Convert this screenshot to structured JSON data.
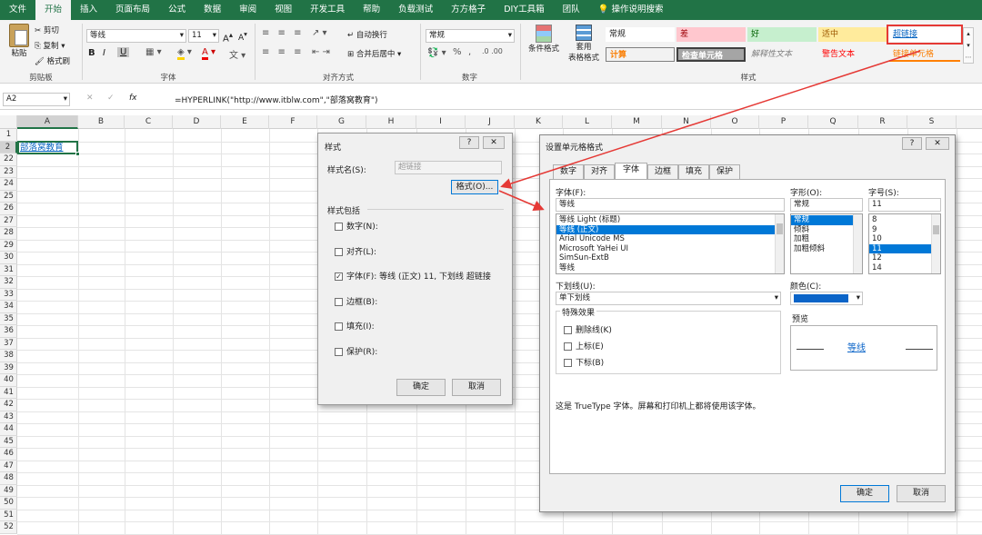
{
  "ribbon_tabs": [
    "文件",
    "开始",
    "插入",
    "页面布局",
    "公式",
    "数据",
    "审阅",
    "视图",
    "开发工具",
    "帮助",
    "负载测试",
    "方方格子",
    "DIY工具箱",
    "团队",
    "操作说明搜索"
  ],
  "clipboard": {
    "paste": "粘贴",
    "cut": "剪切",
    "copy": "复制",
    "format_painter": "格式刷",
    "label": "剪贴板"
  },
  "font": {
    "name": "等线",
    "size": "11",
    "label": "字体",
    "bold": "B",
    "italic": "I",
    "underline": "U",
    "grow": "A",
    "shrink": "A"
  },
  "alignment": {
    "wrap": "自动换行",
    "merge": "合并后居中",
    "label": "对齐方式"
  },
  "number": {
    "format": "常规",
    "percent": "%",
    "comma": ",",
    "label": "数字"
  },
  "styles_group": {
    "conditional": "条件格式",
    "table_format_1": "套用",
    "table_format_2": "表格格式",
    "label": "样式"
  },
  "styles": {
    "normal": "常规",
    "bad": "差",
    "good": "好",
    "neutral": "适中",
    "hyperlink": "超链接",
    "calculation": "计算",
    "check_cell": "检查单元格",
    "explanatory": "解释性文本",
    "warning": "警告文本",
    "linked_cell": "链接单元格"
  },
  "formula_bar": {
    "name_box": "A2",
    "cancel": "✕",
    "enter": "✓",
    "fx": "fx",
    "formula": "=HYPERLINK(\"http://www.itblw.com\",\"部落窝教育\")"
  },
  "columns": [
    "A",
    "B",
    "C",
    "D",
    "E",
    "F",
    "G",
    "H",
    "I",
    "J",
    "K",
    "L",
    "M",
    "N",
    "O",
    "P",
    "Q",
    "R",
    "S"
  ],
  "rows": [
    "1",
    "2",
    "22",
    "23",
    "24",
    "25",
    "26",
    "27",
    "28",
    "29",
    "30",
    "31",
    "32",
    "33",
    "34",
    "35",
    "36",
    "37",
    "38",
    "39",
    "40",
    "41",
    "42",
    "43",
    "44",
    "45",
    "46",
    "47",
    "48",
    "49",
    "50",
    "51",
    "52"
  ],
  "cell_a2": "部落窝教育",
  "style_dialog": {
    "title": "样式",
    "help": "?",
    "close": "✕",
    "style_name_label": "样式名(S):",
    "style_name_value": "超链接",
    "format_button": "格式(O)...",
    "includes_label": "样式包括",
    "items": [
      {
        "label": "数字(N):",
        "checked": false
      },
      {
        "label": "对齐(L):",
        "checked": false
      },
      {
        "label": "字体(F): 等线 (正文) 11, 下划线 超链接",
        "checked": true
      },
      {
        "label": "边框(B):",
        "checked": false
      },
      {
        "label": "填充(I):",
        "checked": false
      },
      {
        "label": "保护(R):",
        "checked": false
      }
    ],
    "ok": "确定",
    "cancel": "取消"
  },
  "format_dialog": {
    "title": "设置单元格格式",
    "help": "?",
    "close": "✕",
    "tabs": [
      "数字",
      "对齐",
      "字体",
      "边框",
      "填充",
      "保护"
    ],
    "font_label": "字体(F):",
    "font_value": "等线",
    "font_list": [
      "等线 Light (标题)",
      "等线 (正文)",
      "Arial Unicode MS",
      "Microsoft YaHei UI",
      "SimSun-ExtB",
      "等线"
    ],
    "style_label": "字形(O):",
    "style_value": "常规",
    "style_list": [
      "常规",
      "倾斜",
      "加粗",
      "加粗倾斜"
    ],
    "size_label": "字号(S):",
    "size_value": "11",
    "size_list": [
      "8",
      "9",
      "10",
      "11",
      "12",
      "14"
    ],
    "underline_label": "下划线(U):",
    "underline_value": "单下划线",
    "color_label": "颜色(C):",
    "effects_label": "特殊效果",
    "effects": [
      "删除线(K)",
      "上标(E)",
      "下标(B)"
    ],
    "preview_label": "预览",
    "preview_text": "等线",
    "note": "这是 TrueType 字体。屏幕和打印机上都将使用该字体。",
    "ok": "确定",
    "cancel": "取消"
  },
  "colors": {
    "excel_green": "#217346",
    "link_blue": "#0563c1",
    "highlight_red": "#e53935",
    "selection": "#0078d7",
    "font_color": "#0a64c8"
  }
}
